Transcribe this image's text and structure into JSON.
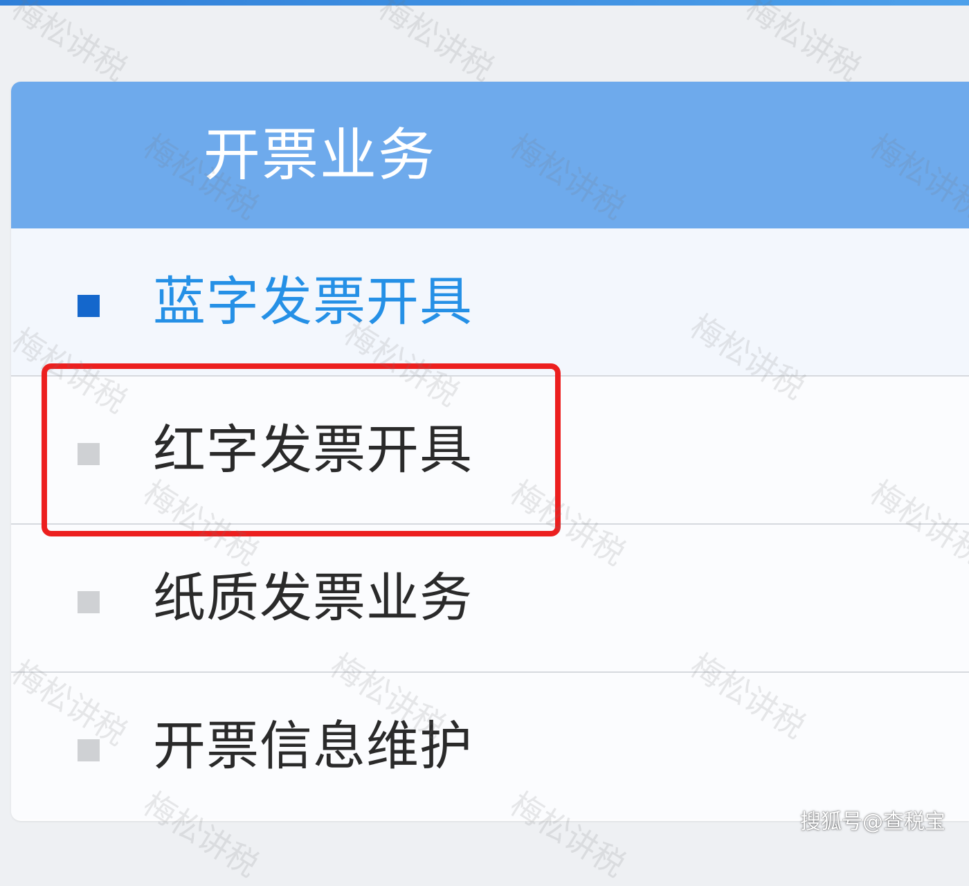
{
  "header": {
    "title": "开票业务"
  },
  "menu": {
    "items": [
      {
        "label": "蓝字发票开具"
      },
      {
        "label": "红字发票开具"
      },
      {
        "label": "纸质发票业务"
      },
      {
        "label": "开票信息维护"
      }
    ]
  },
  "watermark": {
    "text": "梅松讲税"
  },
  "credit": {
    "text": "搜狐号@查税宝"
  },
  "colors": {
    "header_bg": "#6eaaec",
    "active_text": "#2590e6",
    "active_bullet": "#1467cc",
    "inactive_bullet": "#cfd1d4",
    "highlight_border": "#ec1f1f"
  }
}
